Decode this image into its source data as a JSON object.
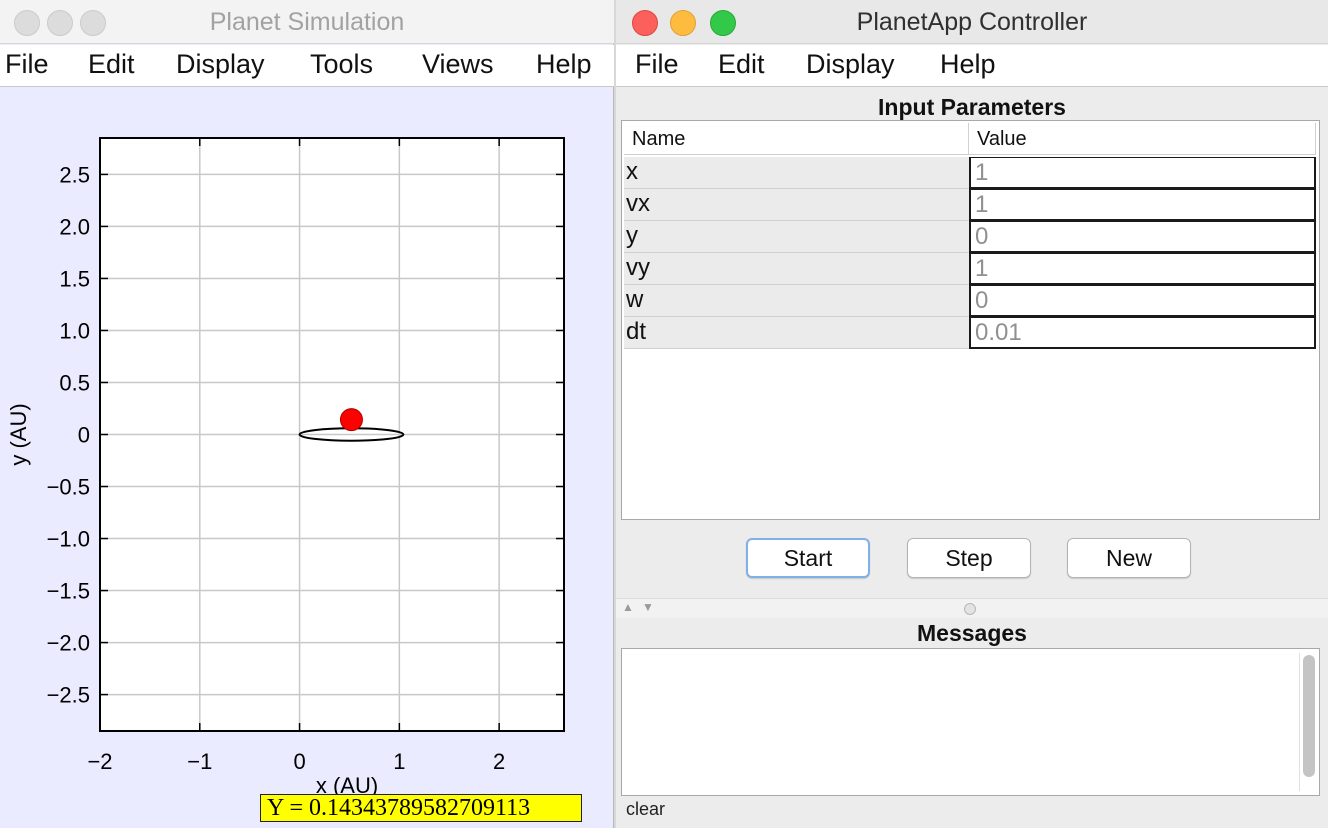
{
  "sim_window": {
    "title": "Planet Simulation",
    "menu": [
      "File",
      "Edit",
      "Display",
      "Tools",
      "Views",
      "Help"
    ],
    "readout": "Y = 0.14343789582709113"
  },
  "chart_data": {
    "type": "scatter",
    "xlabel": "x (AU)",
    "ylabel": "y (AU)",
    "xlim": [
      -2,
      2.65
    ],
    "ylim": [
      -2.85,
      2.85
    ],
    "x_ticks": [
      -2,
      -1,
      0,
      1,
      2
    ],
    "y_ticks": [
      2.5,
      2.0,
      1.5,
      1.0,
      0.5,
      0,
      -0.5,
      -1.0,
      -1.5,
      -2.0,
      -2.5
    ],
    "x_tick_labels": [
      "−2",
      "−1",
      "0",
      "1",
      "2"
    ],
    "y_tick_labels": [
      "2.5",
      "2.0",
      "1.5",
      "1.0",
      "0.5",
      "0",
      "−0.5",
      "−1.0",
      "−1.5",
      "−2.0",
      "−2.5"
    ],
    "grid": true,
    "orbit": {
      "center_x": 0.52,
      "center_y": 0.0,
      "rx": 0.52,
      "ry": 0.06
    },
    "planet": {
      "x": 0.52,
      "y": 0.14343789582709113
    },
    "planet_color": "#ff0000"
  },
  "ctrl_window": {
    "title": "PlanetApp Controller",
    "menu": [
      "File",
      "Edit",
      "Display",
      "Help"
    ],
    "input_header": "Input Parameters",
    "columns": [
      "Name",
      "Value"
    ],
    "params": [
      {
        "name": "x",
        "value": "1"
      },
      {
        "name": "vx",
        "value": "1"
      },
      {
        "name": "y",
        "value": "0"
      },
      {
        "name": "vy",
        "value": "1"
      },
      {
        "name": "w",
        "value": "0"
      },
      {
        "name": "dt",
        "value": "0.01"
      }
    ],
    "buttons": {
      "start": "Start",
      "step": "Step",
      "new": "New"
    },
    "messages_header": "Messages",
    "clear_label": "clear"
  }
}
